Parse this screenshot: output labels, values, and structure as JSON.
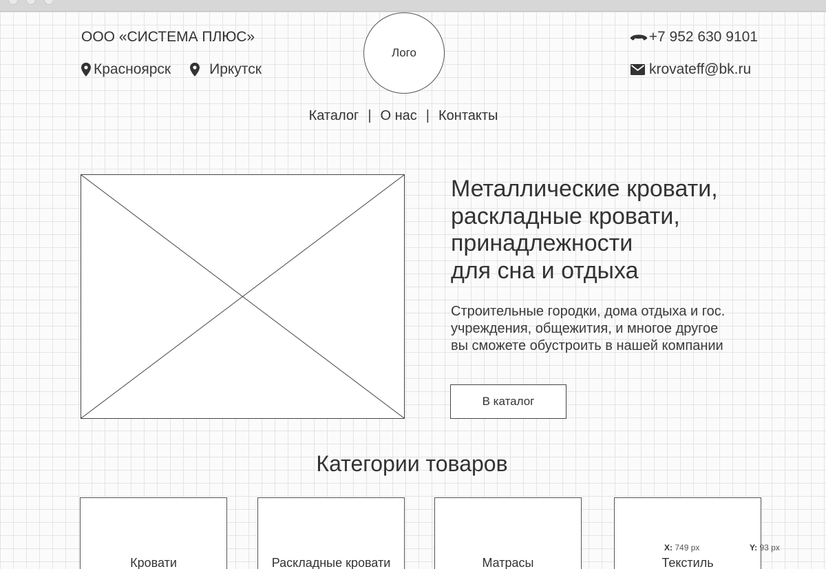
{
  "header": {
    "company": "ООО «СИСТЕМА ПЛЮС»",
    "cities": [
      "Красноярск",
      "Иркутск"
    ],
    "logo": "Лого",
    "phone": "+7 952 630 9101",
    "email": "krovateff@bk.ru"
  },
  "nav": {
    "items": [
      "Каталог",
      "О нас",
      "Контакты"
    ],
    "separator": "|"
  },
  "hero": {
    "title": "Металлические кровати,\nраскладные кровати,\nпринадлежности\nдля сна и отдыха",
    "description": "Строительные городки, дома отдыха и гос. учреждения, общежития, и многое другое вы сможете обустроить в нашей компании",
    "button": "В каталог"
  },
  "categories": {
    "title": "Категории товаров",
    "items": [
      "Кровати",
      "Раскладные кровати",
      "Матрасы",
      "Текстиль"
    ]
  },
  "cursor": {
    "x_label": "X:",
    "x_value": "749 px",
    "y_label": "Y:",
    "y_value": "93 px"
  },
  "icons": {
    "pin": "map-pin-icon",
    "phone": "phone-icon",
    "email": "envelope-icon"
  }
}
